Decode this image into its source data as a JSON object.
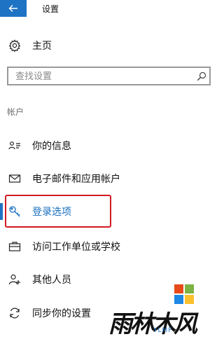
{
  "window": {
    "title": "设置"
  },
  "nav": {
    "home_label": "主页"
  },
  "search": {
    "placeholder": "查找设置"
  },
  "section": {
    "title": "帐户"
  },
  "items": [
    {
      "label": "你的信息",
      "icon": "person-card-icon",
      "selected": false
    },
    {
      "label": "电子邮件和应用帐户",
      "icon": "mail-icon",
      "selected": false
    },
    {
      "label": "登录选项",
      "icon": "key-icon",
      "selected": true
    },
    {
      "label": "访问工作单位或学校",
      "icon": "briefcase-icon",
      "selected": false
    },
    {
      "label": "其他人员",
      "icon": "person-add-icon",
      "selected": false
    },
    {
      "label": "同步你的设置",
      "icon": "sync-icon",
      "selected": false
    }
  ],
  "watermark": {
    "text": "雨林木风",
    "subtext": "YLMF"
  },
  "colors": {
    "accent": "#1f73c4",
    "highlight": "#d11b22"
  }
}
